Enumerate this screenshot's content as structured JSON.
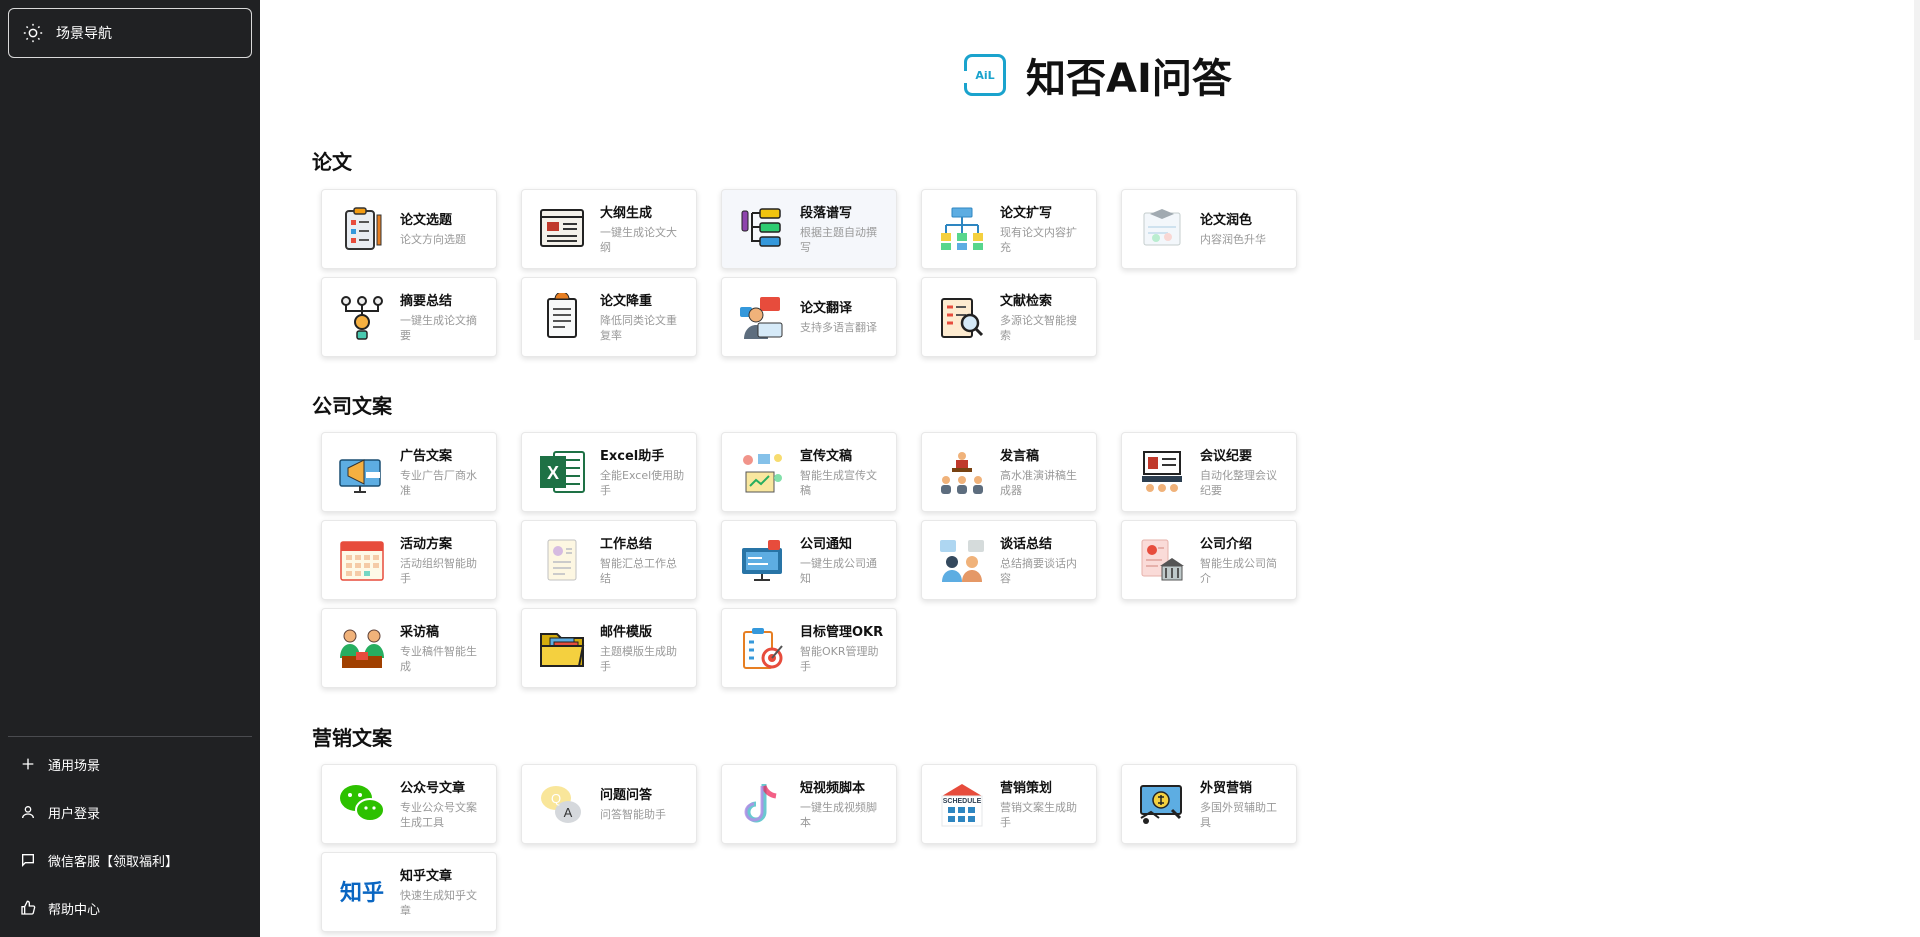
{
  "sidebar": {
    "scene_nav": "场景导航",
    "items": [
      {
        "label": "通用场景",
        "icon": "plus-icon"
      },
      {
        "label": "用户登录",
        "icon": "user-icon"
      },
      {
        "label": "微信客服【领取福利】",
        "icon": "chat-icon"
      },
      {
        "label": "帮助中心",
        "icon": "thumb-up-icon"
      }
    ]
  },
  "header": {
    "logo_text": "AiL",
    "title": "知否AI问答"
  },
  "sections": [
    {
      "title": "论文",
      "cards": [
        {
          "name": "论文选题",
          "desc": "论文方向选题",
          "icon": "clipboard-icon"
        },
        {
          "name": "大纲生成",
          "desc": "一键生成论文大纲",
          "icon": "outline-icon"
        },
        {
          "name": "段落谱写",
          "desc": "根据主题自动撰写",
          "icon": "paragraph-icon"
        },
        {
          "name": "论文扩写",
          "desc": "现有论文内容扩充",
          "icon": "expand-icon"
        },
        {
          "name": "论文润色",
          "desc": "内容润色升华",
          "icon": "polish-icon"
        },
        {
          "name": "摘要总结",
          "desc": "一键生成论文摘要",
          "icon": "summary-icon"
        },
        {
          "name": "论文降重",
          "desc": "降低同类论文重复率",
          "icon": "document-icon"
        },
        {
          "name": "论文翻译",
          "desc": "支持多语言翻译",
          "icon": "translate-icon"
        },
        {
          "name": "文献检索",
          "desc": "多源论文智能搜索",
          "icon": "search-document-icon"
        }
      ]
    },
    {
      "title": "公司文案",
      "cards": [
        {
          "name": "广告文案",
          "desc": "专业广告厂商水准",
          "icon": "megaphone-icon"
        },
        {
          "name": "Excel助手",
          "desc": "全能Excel使用助手",
          "icon": "excel-icon"
        },
        {
          "name": "宣传文稿",
          "desc": "智能生成宣传文稿",
          "icon": "promo-icon"
        },
        {
          "name": "发言稿",
          "desc": "高水准演讲稿生成器",
          "icon": "speech-icon"
        },
        {
          "name": "会议纪要",
          "desc": "自动化整理会议纪要",
          "icon": "meeting-icon"
        },
        {
          "name": "活动方案",
          "desc": "活动组织智能助手",
          "icon": "calendar-icon"
        },
        {
          "name": "工作总结",
          "desc": "智能汇总工作总结",
          "icon": "work-summary-icon"
        },
        {
          "name": "公司通知",
          "desc": "一键生成公司通知",
          "icon": "notice-icon"
        },
        {
          "name": "谈话总结",
          "desc": "总结摘要谈话内容",
          "icon": "conversation-icon"
        },
        {
          "name": "公司介绍",
          "desc": "智能生成公司简介",
          "icon": "company-icon"
        },
        {
          "name": "采访稿",
          "desc": "专业稿件智能生成",
          "icon": "interview-icon"
        },
        {
          "name": "邮件模版",
          "desc": "主题模版生成助手",
          "icon": "folder-icon"
        },
        {
          "name": "目标管理OKR",
          "desc": "智能OKR管理助手",
          "icon": "target-icon"
        }
      ]
    },
    {
      "title": "营销文案",
      "cards": [
        {
          "name": "公众号文章",
          "desc": "专业公众号文案生成工具",
          "icon": "wechat-icon"
        },
        {
          "name": "问题问答",
          "desc": "问答智能助手",
          "icon": "qa-icon"
        },
        {
          "name": "短视频脚本",
          "desc": "一键生成视频脚本",
          "icon": "tiktok-icon"
        },
        {
          "name": "营销策划",
          "desc": "营销文案生成助手",
          "icon": "schedule-icon"
        },
        {
          "name": "外贸营销",
          "desc": "多国外贸辅助工具",
          "icon": "trade-icon"
        },
        {
          "name": "知乎文章",
          "desc": "快速生成知乎文章",
          "icon": "zhihu-icon"
        }
      ]
    }
  ],
  "icon_text": {
    "schedule": "SCHEDULE",
    "qa_q": "Q",
    "qa_a": "A",
    "zhihu": "知乎",
    "excel": "X"
  }
}
